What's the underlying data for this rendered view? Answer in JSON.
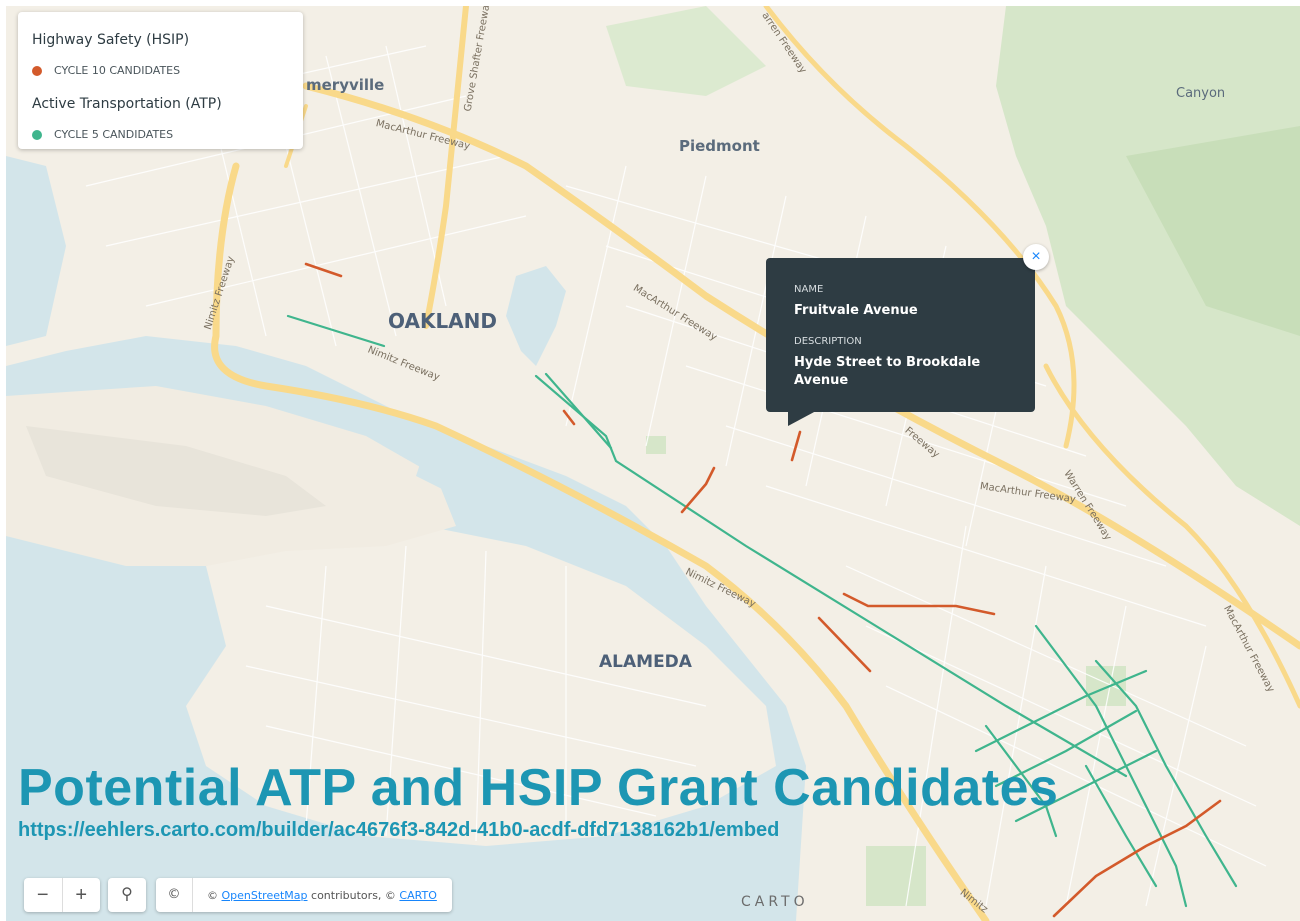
{
  "legend": {
    "groups": [
      {
        "title": "Highway Safety (HSIP)",
        "item": "CYCLE 10 CANDIDATES",
        "color": "#d35a2b"
      },
      {
        "title": "Active Transportation (ATP)",
        "item": "CYCLE 5 CANDIDATES",
        "color": "#3fb58d"
      }
    ]
  },
  "places": {
    "emeryville": "meryville",
    "piedmont": "Piedmont",
    "canyon": "Canyon",
    "oakland": "OAKLAND",
    "alameda": "ALAMEDA"
  },
  "road_labels": {
    "macarthur_1": "MacArthur Freeway",
    "macarthur_2": "MacArthur Freeway",
    "macarthur_3": "MacArthur Freeway",
    "macarthur_4": "MacArthur Freeway",
    "nimitz_1": "Nimitz Freeway",
    "nimitz_2": "Nimitz Freeway",
    "nimitz_3": "Nimitz Freeway",
    "nimitz_4": "Nimitz",
    "grove_shafter": "Grove Shafter Freeway",
    "warren_1": "Warren Freeway",
    "warren_2": "arren Freeway",
    "freeway_frag": "Freeway"
  },
  "popup": {
    "name_label": "NAME",
    "name_value": "Fruitvale Avenue",
    "description_label": "DESCRIPTION",
    "description_value": "Hyde Street to Brookdale Avenue",
    "close_glyph": "×"
  },
  "overlay": {
    "title": "Potential ATP and HSIP Grant Candidates",
    "url": "https://eehlers.carto.com/builder/ac4676f3-842d-41b0-acdf-dfd7138162b1/embed"
  },
  "controls": {
    "zoom_out": "−",
    "zoom_in": "+",
    "search_glyph": "⚲",
    "attribution_glyph": "©",
    "attribution_prefix": "© ",
    "attribution_link1": "OpenStreetMap",
    "attribution_middle": " contributors, © ",
    "attribution_link2": "CARTO",
    "carto_logo": "CARTO"
  },
  "colors": {
    "water": "#d3e5ea",
    "land": "#f3efe6",
    "park": "#d6e6c9",
    "freeway": "#f9d98a",
    "hsip": "#d35a2b",
    "atp": "#3fb58d",
    "popup_bg": "#2e3c43",
    "overlay_text": "#1d96b3"
  }
}
